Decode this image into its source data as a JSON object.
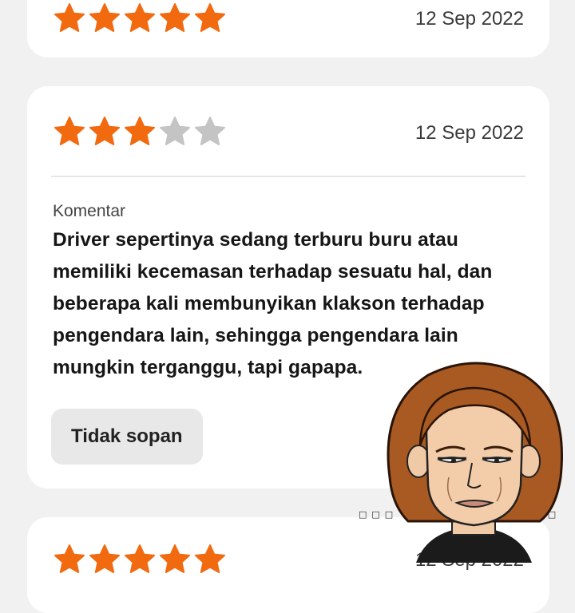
{
  "reviews": [
    {
      "rating": 5,
      "date": "12 Sep 2022"
    },
    {
      "rating": 3,
      "date": "12 Sep 2022",
      "comment_label": "Komentar",
      "comment": "Driver sepertinya sedang terburu buru atau memiliki kecemasan terhadap sesuatu hal, dan beberapa kali membunyikan klakson terhadap pengendara lain, sehingga pengendara lain mungkin terganggu, tapi gapapa.",
      "tag": "Tidak sopan"
    },
    {
      "rating": 5,
      "date": "12 Sep 2022"
    }
  ],
  "colors": {
    "star_filled": "#f26a10",
    "star_empty": "#c4c4c4",
    "background": "#f1f1f1"
  },
  "overlay": {
    "sticker": "man-face-sticker",
    "dots_left": "□□□",
    "dots_right": "□□□"
  }
}
